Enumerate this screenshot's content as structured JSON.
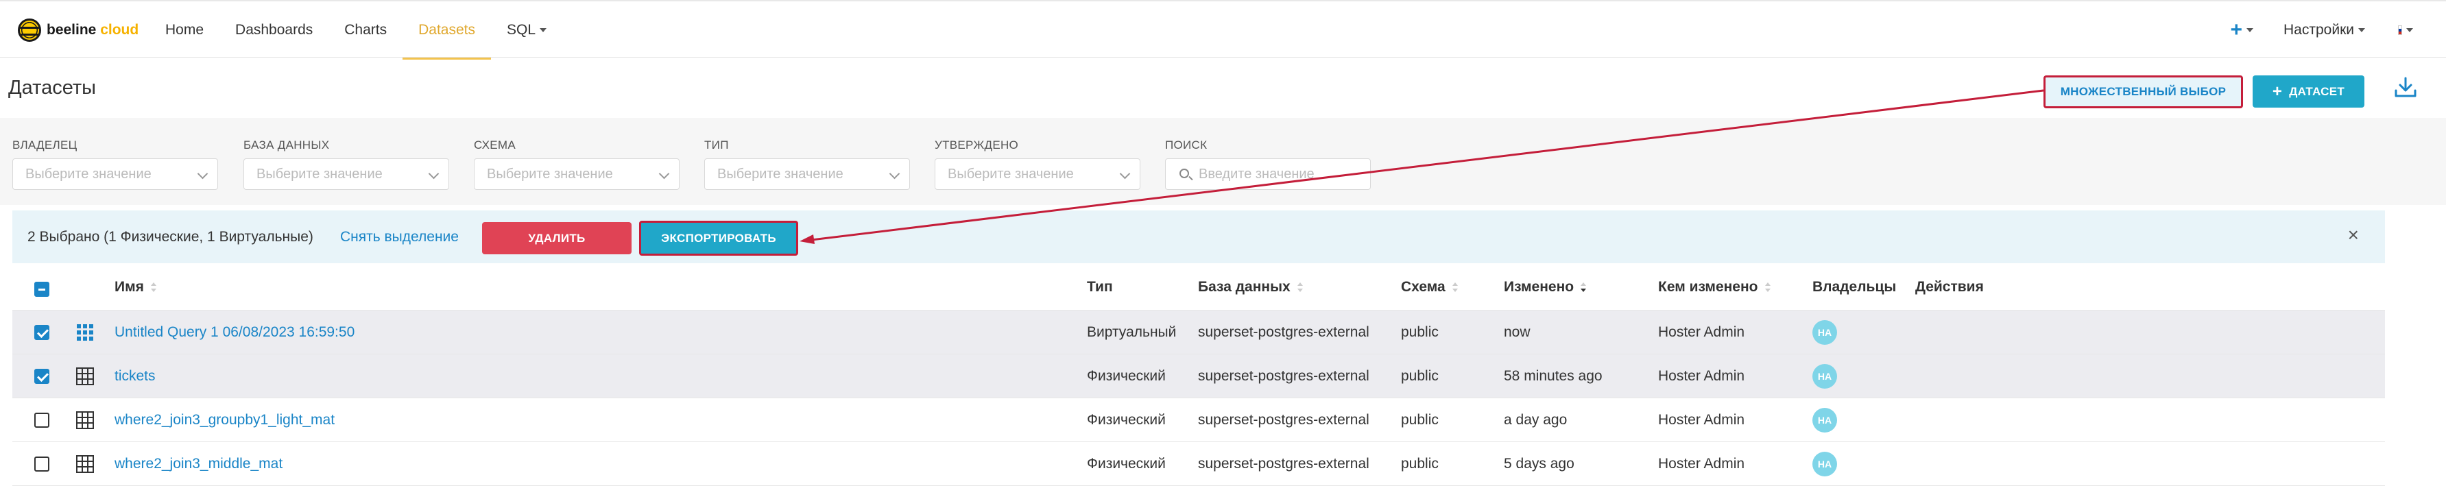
{
  "brand": {
    "name": "beeline",
    "suffix": "cloud"
  },
  "nav": {
    "items": [
      {
        "label": "Home"
      },
      {
        "label": "Dashboards"
      },
      {
        "label": "Charts"
      },
      {
        "label": "Datasets"
      },
      {
        "label": "SQL"
      }
    ],
    "plus": "+",
    "settings": "Настройки"
  },
  "header": {
    "title": "Датасеты",
    "multi_select": "МНОЖЕСТВЕННЫЙ ВЫБОР",
    "add_dataset": "ДАТАСЕТ",
    "add_plus": "+"
  },
  "filters": [
    {
      "label": "ВЛАДЕЛЕЦ",
      "placeholder": "Выберите значение"
    },
    {
      "label": "БАЗА ДАННЫХ",
      "placeholder": "Выберите значение"
    },
    {
      "label": "СХЕМА",
      "placeholder": "Выберите значение"
    },
    {
      "label": "ТИП",
      "placeholder": "Выберите значение"
    },
    {
      "label": "УТВЕРЖДЕНО",
      "placeholder": "Выберите значение"
    },
    {
      "label": "ПОИСК",
      "placeholder": "Введите значение"
    }
  ],
  "bulk": {
    "selected_text": "2 Выбрано (1 Физические, 1 Виртуальные)",
    "deselect": "Снять выделение",
    "delete": "УДАЛИТЬ",
    "export": "ЭКСПОРТИРОВАТЬ",
    "close": "×"
  },
  "table": {
    "columns": [
      "Имя",
      "Тип",
      "База данных",
      "Схема",
      "Изменено",
      "Кем изменено",
      "Владельцы",
      "Действия"
    ],
    "rows": [
      {
        "name": "Untitled Query 1 06/08/2023 16:59:50",
        "type": "Виртуальный",
        "database": "superset-postgres-external",
        "schema": "public",
        "modified": "now",
        "modified_by": "Hoster Admin",
        "owner": "HA",
        "selected": true
      },
      {
        "name": "tickets",
        "type": "Физический",
        "database": "superset-postgres-external",
        "schema": "public",
        "modified": "58 minutes ago",
        "modified_by": "Hoster Admin",
        "owner": "HA",
        "selected": true
      },
      {
        "name": "where2_join3_groupby1_light_mat",
        "type": "Физический",
        "database": "superset-postgres-external",
        "schema": "public",
        "modified": "a day ago",
        "modified_by": "Hoster Admin",
        "owner": "HA",
        "selected": false
      },
      {
        "name": "where2_join3_middle_mat",
        "type": "Физический",
        "database": "superset-postgres-external",
        "schema": "public",
        "modified": "5 days ago",
        "modified_by": "Hoster Admin",
        "owner": "HA",
        "selected": false
      }
    ]
  },
  "colors": {
    "accent": "#20a7c9",
    "link": "#1a85c7",
    "danger": "#e04355",
    "annotation": "#c41e3a",
    "active_nav": "#e0a82e"
  }
}
